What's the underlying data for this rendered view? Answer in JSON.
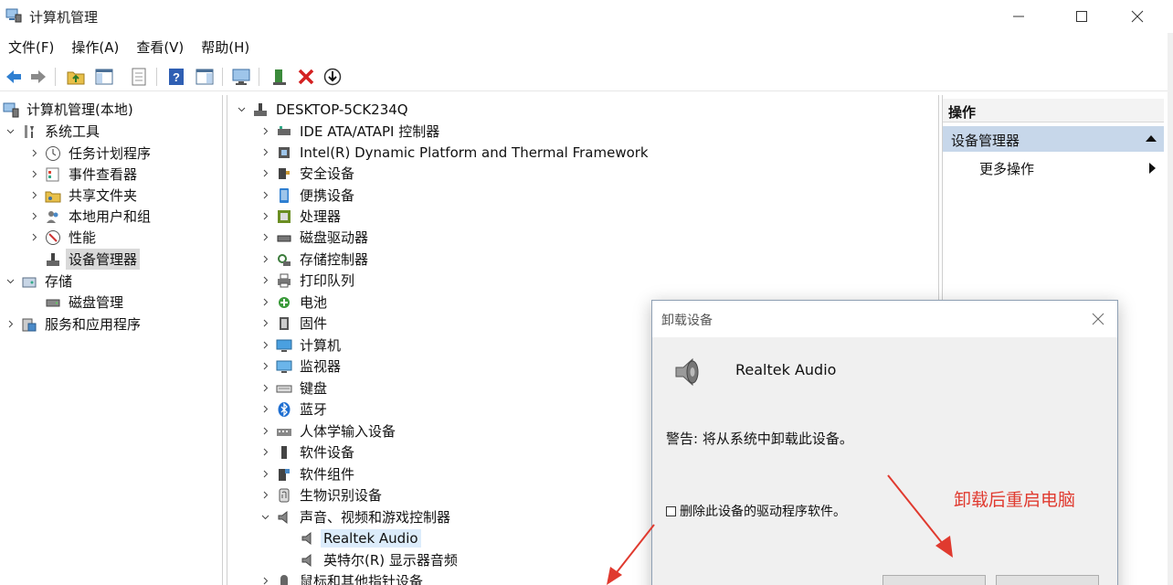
{
  "window": {
    "title": "计算机管理",
    "minimize_icon": "minimize-icon",
    "maximize_icon": "maximize-icon",
    "close_icon": "close-icon"
  },
  "menu": {
    "items": [
      "文件(F)",
      "操作(A)",
      "查看(V)",
      "帮助(H)"
    ]
  },
  "toolbar": {
    "buttons": [
      "back-arrow-icon",
      "forward-arrow-icon",
      "up-folder-icon",
      "show-hide-tree-icon",
      "properties-icon",
      "help-icon",
      "show-action-pane-icon",
      "monitor-scan-icon",
      "enable-device-icon",
      "uninstall-device-icon",
      "update-driver-icon"
    ]
  },
  "tree": {
    "root": "计算机管理(本地)",
    "items": [
      {
        "label": "系统工具",
        "expanded": true
      },
      {
        "label": "任务计划程序"
      },
      {
        "label": "事件查看器"
      },
      {
        "label": "共享文件夹"
      },
      {
        "label": "本地用户和组"
      },
      {
        "label": "性能"
      },
      {
        "label": "设备管理器",
        "selected": true
      },
      {
        "label": "存储",
        "expanded": true
      },
      {
        "label": "磁盘管理"
      },
      {
        "label": "服务和应用程序"
      }
    ]
  },
  "devices": {
    "computer": "DESKTOP-5CK234Q",
    "categories": [
      "IDE ATA/ATAPI 控制器",
      "Intel(R) Dynamic Platform and Thermal Framework",
      "安全设备",
      "便携设备",
      "处理器",
      "磁盘驱动器",
      "存储控制器",
      "打印队列",
      "电池",
      "固件",
      "计算机",
      "监视器",
      "键盘",
      "蓝牙",
      "人体学输入设备",
      "软件设备",
      "软件组件",
      "生物识别设备",
      "声音、视频和游戏控制器"
    ],
    "audio_children": [
      "Realtek Audio",
      "英特尔(R) 显示器音频"
    ],
    "next_category": "鼠标和其他指针设备"
  },
  "actions": {
    "header": "操作",
    "section": "设备管理器",
    "more": "更多操作"
  },
  "dialog": {
    "title": "卸载设备",
    "device_name": "Realtek Audio",
    "warning": "警告: 将从系统中卸载此设备。",
    "checkbox_label": "删除此设备的驱动程序软件。",
    "checkbox_checked": false
  },
  "annotation": {
    "text": "卸载后重启电脑",
    "color": "#e03a2f"
  }
}
